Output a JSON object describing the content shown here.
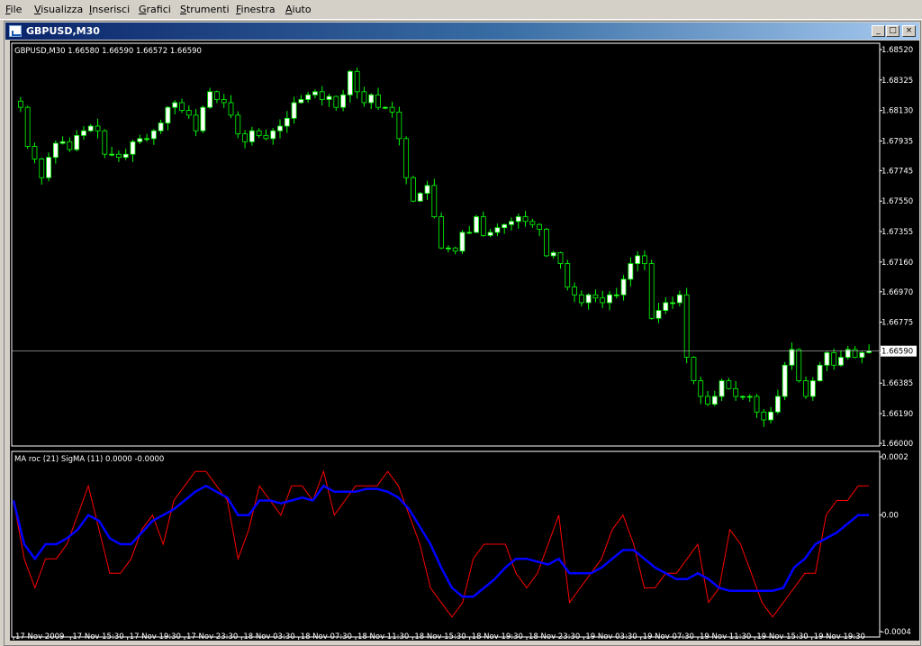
{
  "menu": [
    {
      "id": "m-file",
      "u": "F",
      "rest": "ile"
    },
    {
      "id": "m-view",
      "u": "V",
      "rest": "isualizza"
    },
    {
      "id": "m-insert",
      "u": "I",
      "rest": "nserisci"
    },
    {
      "id": "m-charts",
      "u": "G",
      "rest": "rafici"
    },
    {
      "id": "m-tools",
      "u": "S",
      "rest": "trumenti"
    },
    {
      "id": "m-window",
      "u": "F",
      "rest": "inestra"
    },
    {
      "id": "m-help",
      "u": "A",
      "rest": "iuto"
    }
  ],
  "window": {
    "title": "GBPUSD,M30",
    "btn_min": "_",
    "btn_max": "□",
    "btn_close": "×"
  },
  "colors": {
    "bull": "#ffffff",
    "wick": "#00ff00",
    "bear": "#000000",
    "roc_line": "#ff0000",
    "sig_line": "#0000ff",
    "current_price_line": "#c0c0c0"
  },
  "chart_data": [
    {
      "type": "candlestick",
      "title": "GBPUSD,M30",
      "ohlc_header": "1.66580 1.66590 1.66572 1.66590",
      "ylim": [
        1.66,
        1.6852
      ],
      "y_ticks": [
        "1.68520",
        "1.68325",
        "1.68130",
        "1.67935",
        "1.67745",
        "1.67550",
        "1.67355",
        "1.67160",
        "1.66970",
        "1.66775",
        "1.66580",
        "1.66385",
        "1.66190",
        "1.66000"
      ],
      "current_price": "1.66590",
      "x_ticks": [
        "17 Nov 2009",
        "17 Nov 15:30",
        "17 Nov 19:30",
        "17 Nov 23:30",
        "18 Nov 03:30",
        "18 Nov 07:30",
        "18 Nov 11:30",
        "18 Nov 15:30",
        "18 Nov 19:30",
        "18 Nov 23:30",
        "19 Nov 03:30",
        "19 Nov 07:30",
        "19 Nov 11:30",
        "19 Nov 15:30",
        "19 Nov 19:30"
      ],
      "closes": [
        1.6815,
        1.679,
        1.6782,
        1.677,
        1.6783,
        1.6792,
        1.6793,
        1.6788,
        1.6797,
        1.68,
        1.6803,
        1.68,
        1.6785,
        1.6785,
        1.6783,
        1.6785,
        1.6793,
        1.6795,
        1.6795,
        1.68,
        1.6805,
        1.6815,
        1.6818,
        1.6813,
        1.681,
        1.68,
        1.6815,
        1.6825,
        1.682,
        1.6818,
        1.681,
        1.6798,
        1.6793,
        1.68,
        1.6797,
        1.6795,
        1.68,
        1.6803,
        1.6808,
        1.6818,
        1.682,
        1.6823,
        1.6825,
        1.682,
        1.6822,
        1.6815,
        1.6823,
        1.6838,
        1.6825,
        1.6818,
        1.6823,
        1.6815,
        1.6815,
        1.6812,
        1.6795,
        1.677,
        1.6755,
        1.676,
        1.6765,
        1.6745,
        1.6725,
        1.6725,
        1.6723,
        1.6735,
        1.6735,
        1.6745,
        1.6733,
        1.6735,
        1.6738,
        1.674,
        1.6742,
        1.6745,
        1.6742,
        1.674,
        1.6737,
        1.672,
        1.6722,
        1.6715,
        1.67,
        1.6695,
        1.669,
        1.6695,
        1.6693,
        1.669,
        1.6695,
        1.6695,
        1.6705,
        1.6715,
        1.672,
        1.6715,
        1.668,
        1.6685,
        1.669,
        1.669,
        1.6695,
        1.6655,
        1.664,
        1.663,
        1.6625,
        1.663,
        1.664,
        1.6635,
        1.663,
        1.663,
        1.663,
        1.662,
        1.6615,
        1.662,
        1.663,
        1.665,
        1.666,
        1.664,
        1.663,
        1.664,
        1.665,
        1.6658,
        1.665,
        1.6655,
        1.666,
        1.6655,
        1.6658,
        1.6659
      ]
    },
    {
      "type": "line",
      "title": "MA roc (21) SigMA (11)",
      "header_values": "0.0000 -0.0000",
      "ylim": [
        -0.0004,
        0.0002
      ],
      "y_ticks": [
        "0.0002",
        "0.00",
        "-0.0004"
      ],
      "series": [
        {
          "name": "MA roc (21)",
          "values": [
            5e-05,
            -0.00015,
            -0.00025,
            -0.00015,
            -0.00015,
            -0.0001,
            0.0,
            0.0001,
            -5e-05,
            -0.0002,
            -0.0002,
            -0.00015,
            -5e-05,
            0.0,
            -0.0001,
            5e-05,
            0.0001,
            0.00015,
            0.00015,
            0.0001,
            5e-05,
            -0.00015,
            -5e-05,
            0.0001,
            5e-05,
            0.0,
            0.0001,
            0.0001,
            5e-05,
            0.00015,
            0.0,
            5e-05,
            0.0001,
            0.0001,
            0.0001,
            0.00015,
            0.0001,
            0.0,
            -0.0001,
            -0.00025,
            -0.0003,
            -0.00035,
            -0.0003,
            -0.00015,
            -0.0001,
            -0.0001,
            -0.0001,
            -0.0002,
            -0.00025,
            -0.0002,
            -0.0001,
            0.0,
            -0.0003,
            -0.00025,
            -0.0002,
            -0.00015,
            -5e-05,
            0.0,
            -0.0001,
            -0.00025,
            -0.00025,
            -0.0002,
            -0.0002,
            -0.00015,
            -0.0001,
            -0.0003,
            -0.00025,
            -5e-05,
            -0.0001,
            -0.0002,
            -0.0003,
            -0.00035,
            -0.0003,
            -0.00025,
            -0.0002,
            -0.0002,
            0.0,
            5e-05,
            5e-05,
            0.0001,
            0.0001
          ]
        },
        {
          "name": "SigMA (11)",
          "values": [
            5e-05,
            -0.0001,
            -0.00015,
            -0.0001,
            -0.0001,
            -8e-05,
            -5e-05,
            0.0,
            -2e-05,
            -8e-05,
            -0.0001,
            -0.0001,
            -6e-05,
            -2e-05,
            0.0,
            2e-05,
            5e-05,
            8e-05,
            0.0001,
            8e-05,
            6e-05,
            0.0,
            0.0,
            5e-05,
            5e-05,
            4e-05,
            5e-05,
            6e-05,
            5e-05,
            0.0001,
            8e-05,
            8e-05,
            8e-05,
            9e-05,
            9e-05,
            8e-05,
            6e-05,
            2e-05,
            -4e-05,
            -0.0001,
            -0.00018,
            -0.00025,
            -0.00028,
            -0.00028,
            -0.00025,
            -0.00022,
            -0.00018,
            -0.00015,
            -0.00015,
            -0.00016,
            -0.00017,
            -0.00015,
            -0.0002,
            -0.0002,
            -0.0002,
            -0.00018,
            -0.00015,
            -0.00012,
            -0.00012,
            -0.00015,
            -0.00018,
            -0.0002,
            -0.00022,
            -0.00022,
            -0.0002,
            -0.00022,
            -0.00025,
            -0.00026,
            -0.00026,
            -0.00026,
            -0.00026,
            -0.00026,
            -0.00025,
            -0.00018,
            -0.00015,
            -0.0001,
            -8e-05,
            -6e-05,
            -3e-05,
            0.0,
            0.0
          ]
        }
      ]
    }
  ]
}
